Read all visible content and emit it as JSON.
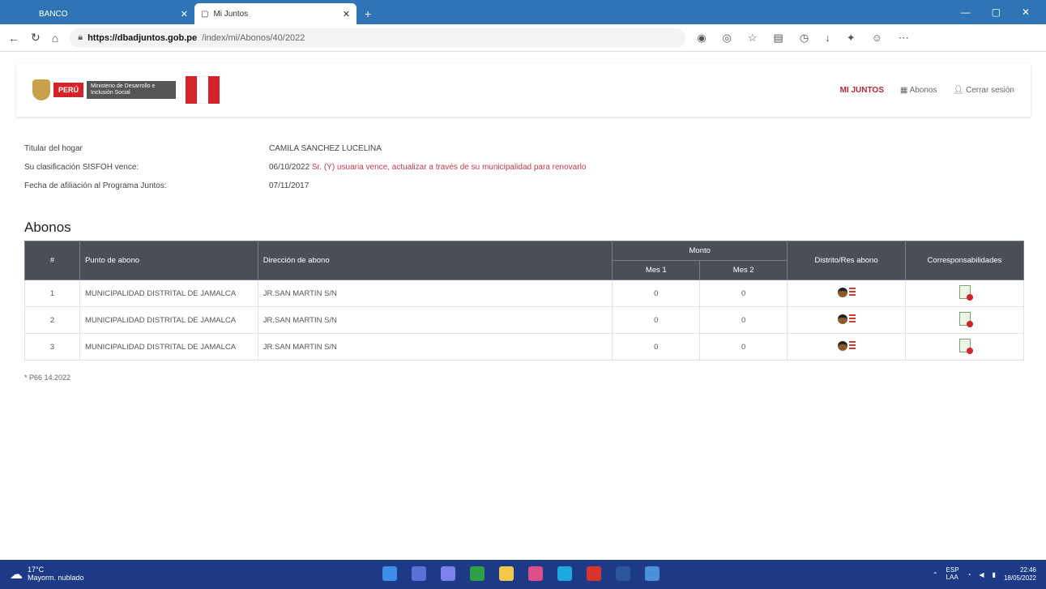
{
  "browser": {
    "tabs": [
      {
        "label": "BANCO",
        "active": false
      },
      {
        "label": "Mi Juntos",
        "active": true
      }
    ],
    "url_domain": "https://dbadjuntos.gob.pe",
    "url_path": "/index/mi/Abonos/40/2022"
  },
  "header": {
    "brand_peru": "PERÚ",
    "brand_ministry": "Ministerio de Desarrollo e Inclusión Social",
    "nav": {
      "mi_juntos": "MI JUNTOS",
      "abonos": "Abonos",
      "cerrar_sesion": "Cerrar sesión"
    }
  },
  "info": {
    "titular_label": "Titular del hogar",
    "titular_value": "CAMILA SANCHEZ LUCELINA",
    "clasif_label": "Su clasificación SISFOH vence:",
    "clasif_date": "06/10/2022",
    "clasif_note": "Sr. (Y) usuaria vence, actualizar a través de su municipalidad para renovarlo",
    "afiliacion_label": "Fecha de afiliación al Programa Juntos:",
    "afiliacion_value": "07/11/2017"
  },
  "section_title": "Abonos",
  "table": {
    "headers": {
      "num": "#",
      "punto": "Punto de abono",
      "direccion": "Dirección de abono",
      "monto": "Monto",
      "mes1": "Mes 1",
      "mes2": "Mes 2",
      "distrito": "Distrito/Res abono",
      "corresponsabilidades": "Corresponsabilidades"
    },
    "rows": [
      {
        "num": "1",
        "punto": "MUNICIPALIDAD DISTRITAL DE JAMALCA",
        "direccion": "JR.SAN MARTIN S/N",
        "mes1": "0",
        "mes2": "0"
      },
      {
        "num": "2",
        "punto": "MUNICIPALIDAD DISTRITAL DE JAMALCA",
        "direccion": "JR.SAN MARTIN S/N",
        "mes1": "0",
        "mes2": "0"
      },
      {
        "num": "3",
        "punto": "MUNICIPALIDAD DISTRITAL DE JAMALCA",
        "direccion": "JR.SAN MARTIN S/N",
        "mes1": "0",
        "mes2": "0"
      }
    ]
  },
  "footnote": "* P66 14.2022",
  "taskbar": {
    "temp": "17°C",
    "weather": "Mayorm. nublado",
    "lang": "ESP",
    "lang2": "LAA",
    "time": "22:46",
    "date": "18/05/2022"
  },
  "colors": {
    "accent": "#2f74b5",
    "table_header": "#4a4f57",
    "taskbar": "#1d3a86",
    "warning_text": "#c43a4a"
  }
}
